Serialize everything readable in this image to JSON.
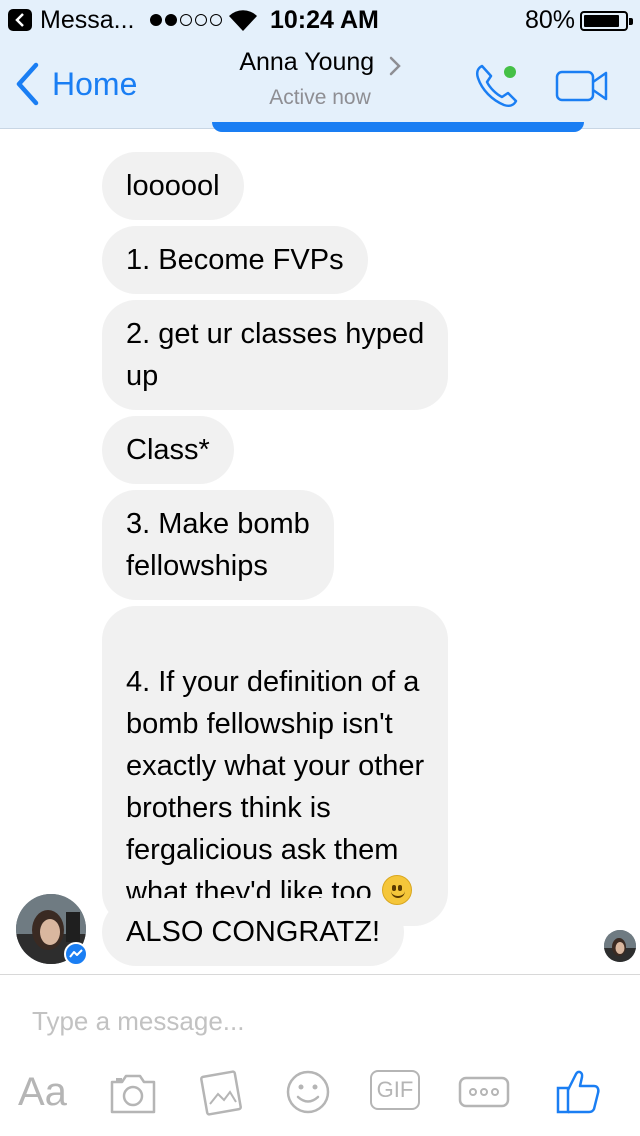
{
  "status_bar": {
    "app_back_label": "Messa...",
    "time": "10:24 AM",
    "battery_percent": "80%"
  },
  "nav": {
    "back_label": "Home",
    "contact_name": "Anna Young",
    "contact_status": "Active now"
  },
  "messages": [
    {
      "text": "loooool"
    },
    {
      "text": "1. Become FVPs"
    },
    {
      "text": "2. get ur classes hyped\nup"
    },
    {
      "text": "Class*"
    },
    {
      "text": "3. Make bomb\nfellowships"
    },
    {
      "text": "4. If your definition of a\nbomb fellowship isn't\nexactly what your other\nbrothers think is\nfergalicious ask them\nwhat they'd like too",
      "emoji": "slightly-smiling-face"
    },
    {
      "text": "ALSO CONGRATZ!"
    }
  ],
  "composer": {
    "placeholder": "Type a message...",
    "text_button_label": "Aa",
    "gif_label": "GIF"
  },
  "colors": {
    "accent": "#1a7ef3",
    "bar_background": "#e4f0fb",
    "bubble_received": "#f1f1f1",
    "active_dot": "#44c046",
    "icon_gray": "#b5b5b5"
  }
}
